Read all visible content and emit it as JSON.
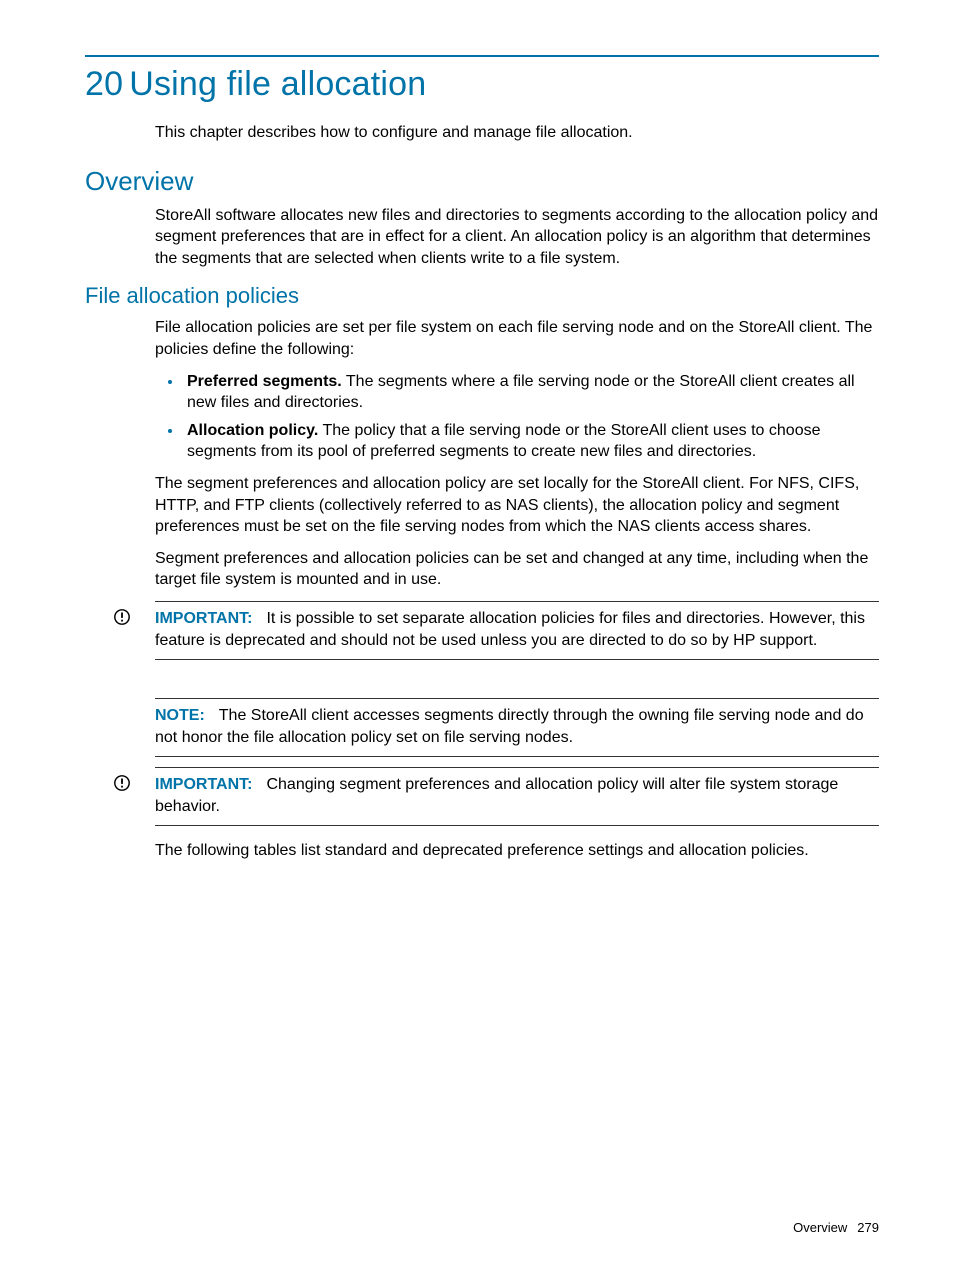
{
  "chapter": {
    "number": "20",
    "title": "Using file allocation",
    "intro": "This chapter describes how to configure and manage file allocation."
  },
  "overview": {
    "heading": "Overview",
    "para": "StoreAll software allocates new files and directories to segments according to the allocation policy and segment preferences that are in effect for a client. An allocation policy is an algorithm that determines the segments that are selected when clients write to a file system."
  },
  "policies": {
    "heading": "File allocation policies",
    "intro": "File allocation policies are set per file system on each file serving node and on the StoreAll client. The policies define the following:",
    "bullets": [
      {
        "term": "Preferred segments.",
        "desc": " The segments where a file serving node or the StoreAll client creates all new files and directories."
      },
      {
        "term": "Allocation policy.",
        "desc": " The policy that a file serving node or the StoreAll client uses to choose segments from its pool of preferred segments to create new files and directories."
      }
    ],
    "para2": "The segment preferences and allocation policy are set locally for the StoreAll client. For NFS, CIFS, HTTP, and FTP clients (collectively referred to as NAS clients), the allocation policy and segment preferences must be set on the file serving nodes from which the NAS clients access shares.",
    "para3": "Segment preferences and allocation policies can be set and changed at any time, including when the target file system is mounted and in use."
  },
  "callouts": {
    "important1": {
      "label": "IMPORTANT:",
      "text": "It is possible to set separate allocation policies for files and directories. However, this feature is deprecated and should not be used unless you are directed to do so by HP support."
    },
    "note1": {
      "label": "NOTE:",
      "text": "The StoreAll client accesses segments directly through the owning file serving node and do not honor the file allocation policy set on file serving nodes."
    },
    "important2": {
      "label": "IMPORTANT:",
      "text": "Changing segment preferences and allocation policy will alter file system storage behavior."
    }
  },
  "closing": "The following tables list standard and deprecated preference settings and allocation policies.",
  "footer": {
    "section": "Overview",
    "page": "279"
  }
}
